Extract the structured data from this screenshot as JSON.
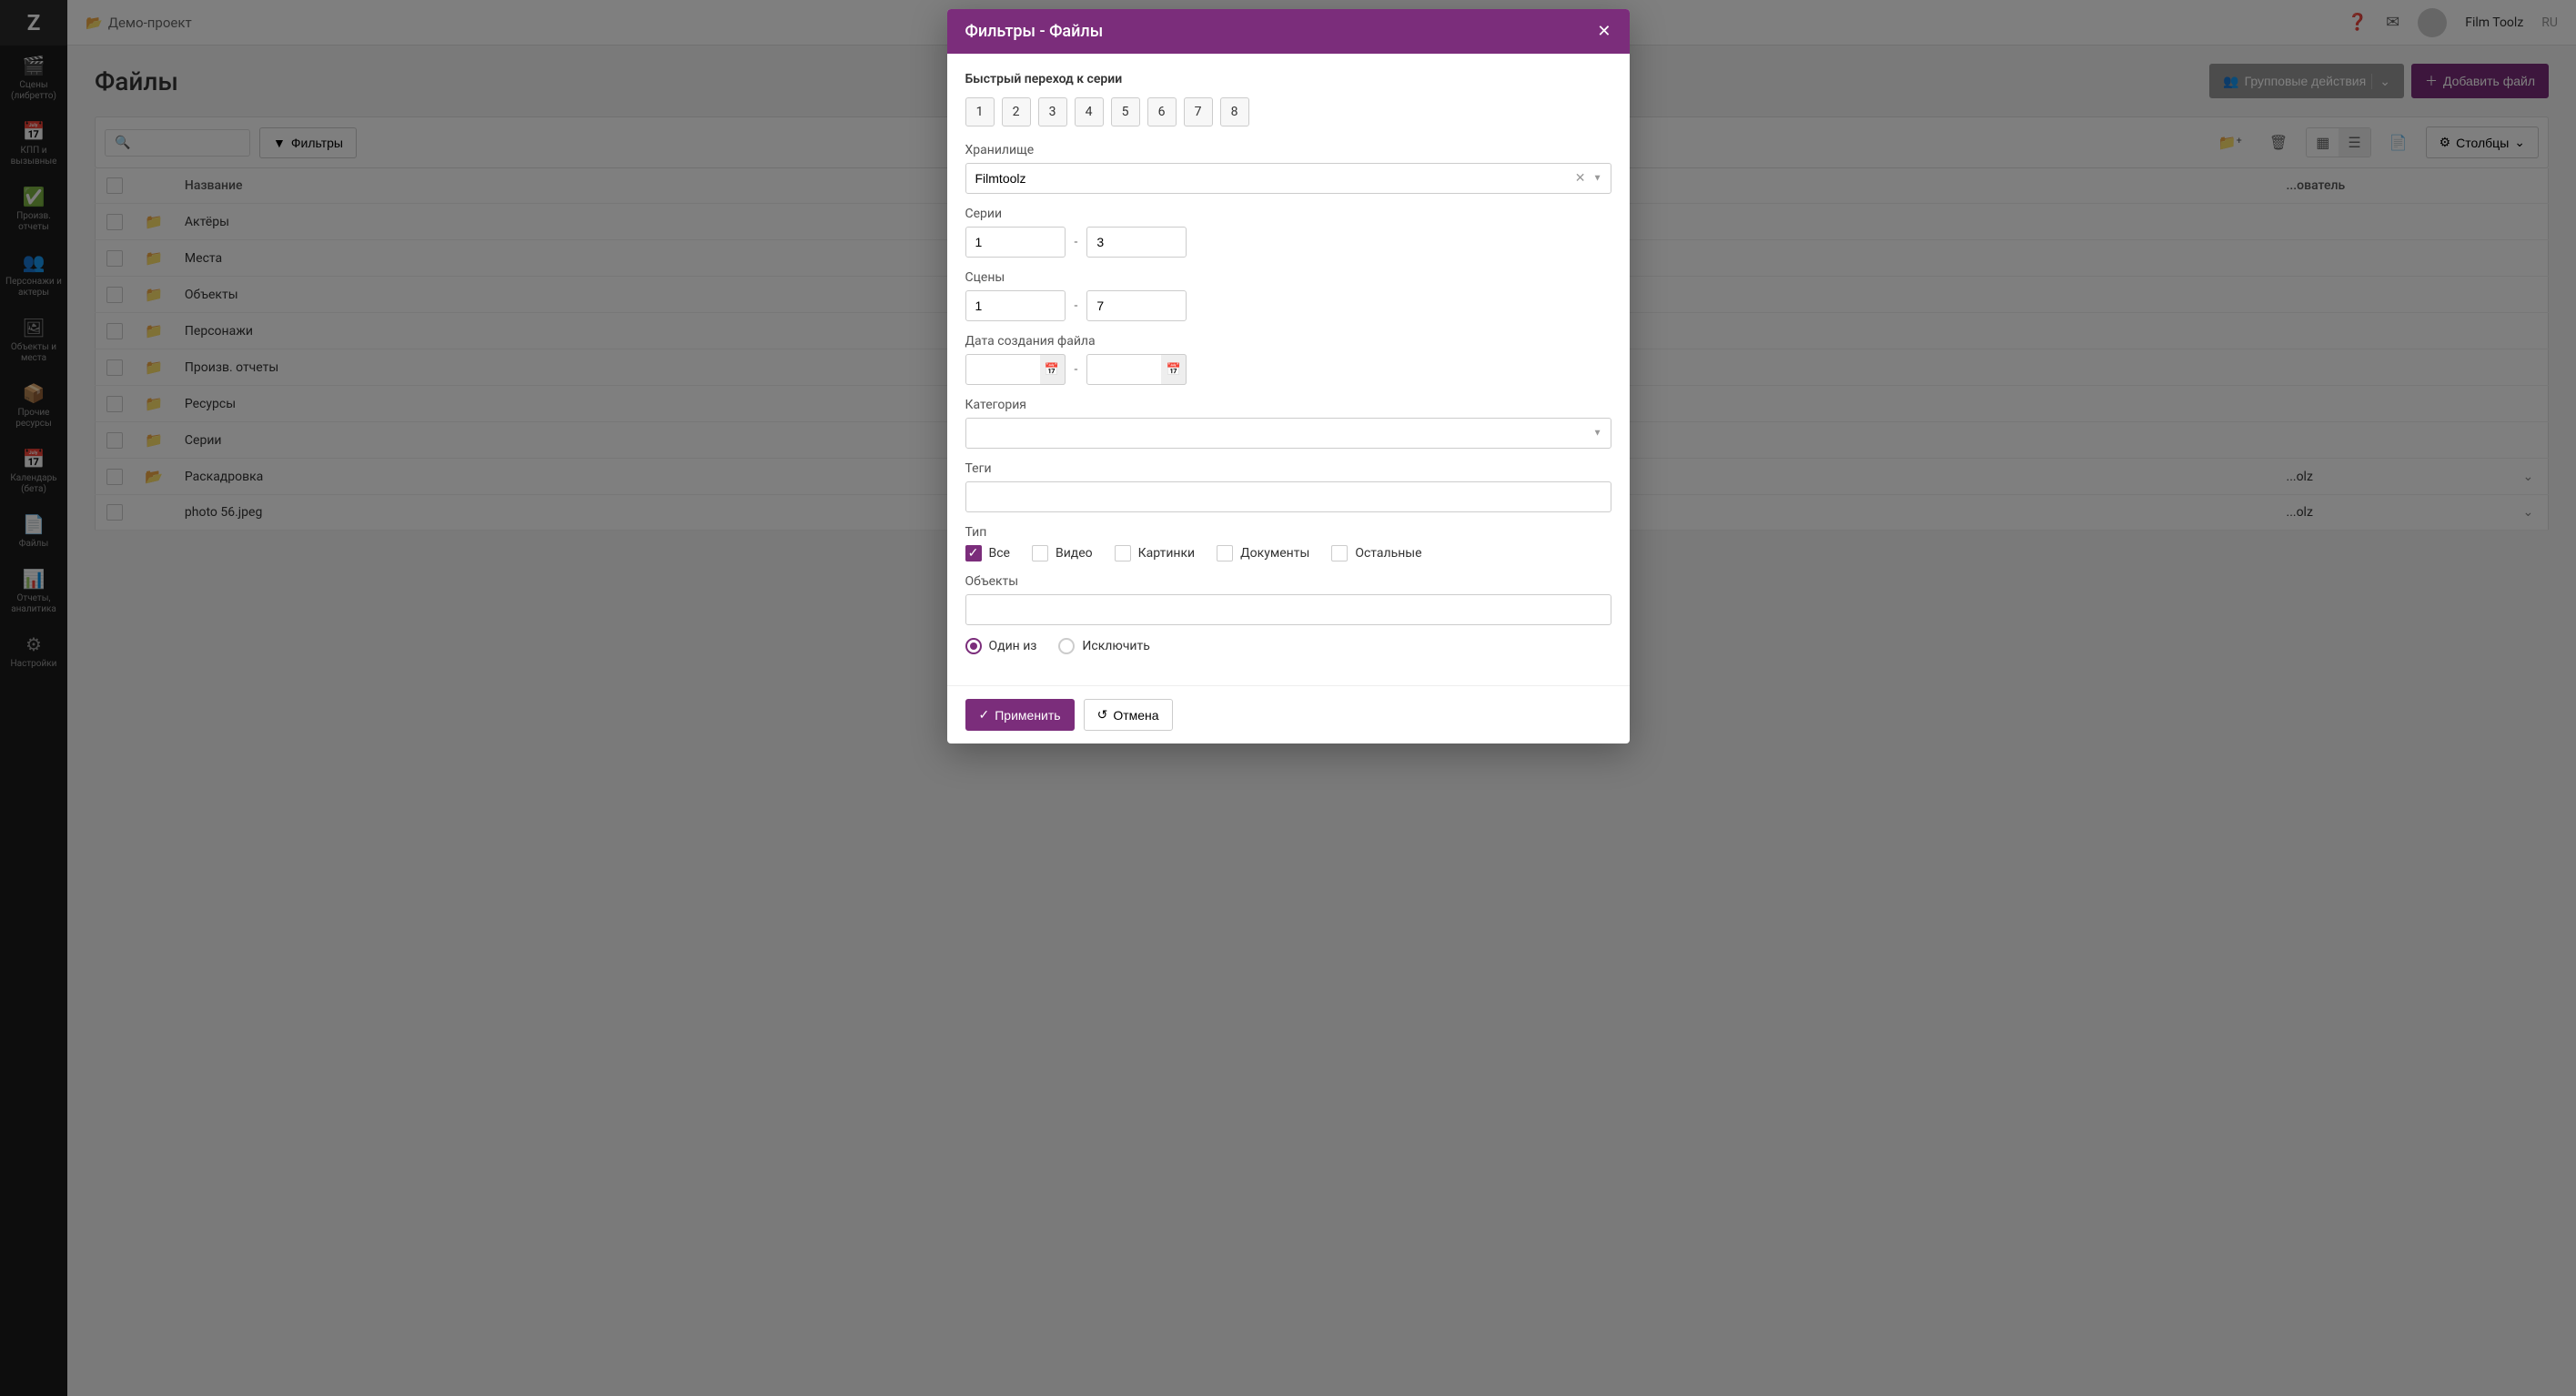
{
  "sidebar": {
    "logo": "Z",
    "items": [
      {
        "icon": "🎬",
        "label": "Сцены (либретто)"
      },
      {
        "icon": "📅",
        "label": "КПП и вызывные"
      },
      {
        "icon": "✅",
        "label": "Произв. отчеты"
      },
      {
        "icon": "👥",
        "label": "Персонажи и актеры"
      },
      {
        "icon": "🖼",
        "label": "Объекты и места"
      },
      {
        "icon": "📦",
        "label": "Прочие ресурсы"
      },
      {
        "icon": "📅",
        "label": "Календарь (бета)"
      },
      {
        "icon": "📄",
        "label": "Файлы"
      },
      {
        "icon": "📊",
        "label": "Отчеты, аналитика"
      },
      {
        "icon": "⚙",
        "label": "Настройки"
      }
    ]
  },
  "topbar": {
    "breadcrumb_icon": "📂",
    "breadcrumb": "Демо-проект",
    "user": "Film Toolz",
    "lang": "RU"
  },
  "page": {
    "title": "Файлы",
    "group_actions": "Групповые действия",
    "add_file": "Добавить файл",
    "filters_btn": "Фильтры",
    "columns_btn": "Столбцы"
  },
  "table": {
    "headers": {
      "name": "Название",
      "user": "...ователь"
    },
    "rows": [
      {
        "type": "folder",
        "name": "Актёры"
      },
      {
        "type": "folder",
        "name": "Места"
      },
      {
        "type": "folder",
        "name": "Объекты"
      },
      {
        "type": "folder",
        "name": "Персонажи"
      },
      {
        "type": "folder",
        "name": "Произв. отчеты"
      },
      {
        "type": "folder",
        "name": "Ресурсы"
      },
      {
        "type": "folder",
        "name": "Серии"
      },
      {
        "type": "folder-outline",
        "name": "Раскадровка",
        "user": "...olz",
        "chevron": true
      },
      {
        "type": "file",
        "name": "photo 56.jpeg",
        "user": "...olz",
        "chevron": true
      }
    ]
  },
  "modal": {
    "title": "Фильтры - Файлы",
    "quick_jump": "Быстрый переход к серии",
    "series_buttons": [
      "1",
      "2",
      "3",
      "4",
      "5",
      "6",
      "7",
      "8"
    ],
    "storage": {
      "label": "Хранилище",
      "value": "Filmtoolz"
    },
    "series": {
      "label": "Серии",
      "from": "1",
      "to": "3"
    },
    "scenes": {
      "label": "Сцены",
      "from": "1",
      "to": "7"
    },
    "created": {
      "label": "Дата создания файла",
      "from": "",
      "to": ""
    },
    "category": {
      "label": "Категория",
      "value": ""
    },
    "tags": {
      "label": "Теги",
      "value": ""
    },
    "type": {
      "label": "Тип",
      "options": [
        {
          "id": "all",
          "label": "Все",
          "checked": true
        },
        {
          "id": "video",
          "label": "Видео",
          "checked": false
        },
        {
          "id": "images",
          "label": "Картинки",
          "checked": false
        },
        {
          "id": "docs",
          "label": "Документы",
          "checked": false
        },
        {
          "id": "other",
          "label": "Остальные",
          "checked": false
        }
      ]
    },
    "objects": {
      "label": "Объекты",
      "value": ""
    },
    "mode": {
      "options": [
        {
          "id": "oneof",
          "label": "Один из",
          "checked": true
        },
        {
          "id": "exclude",
          "label": "Исключить",
          "checked": false
        }
      ]
    },
    "apply": "Применить",
    "cancel": "Отмена"
  }
}
